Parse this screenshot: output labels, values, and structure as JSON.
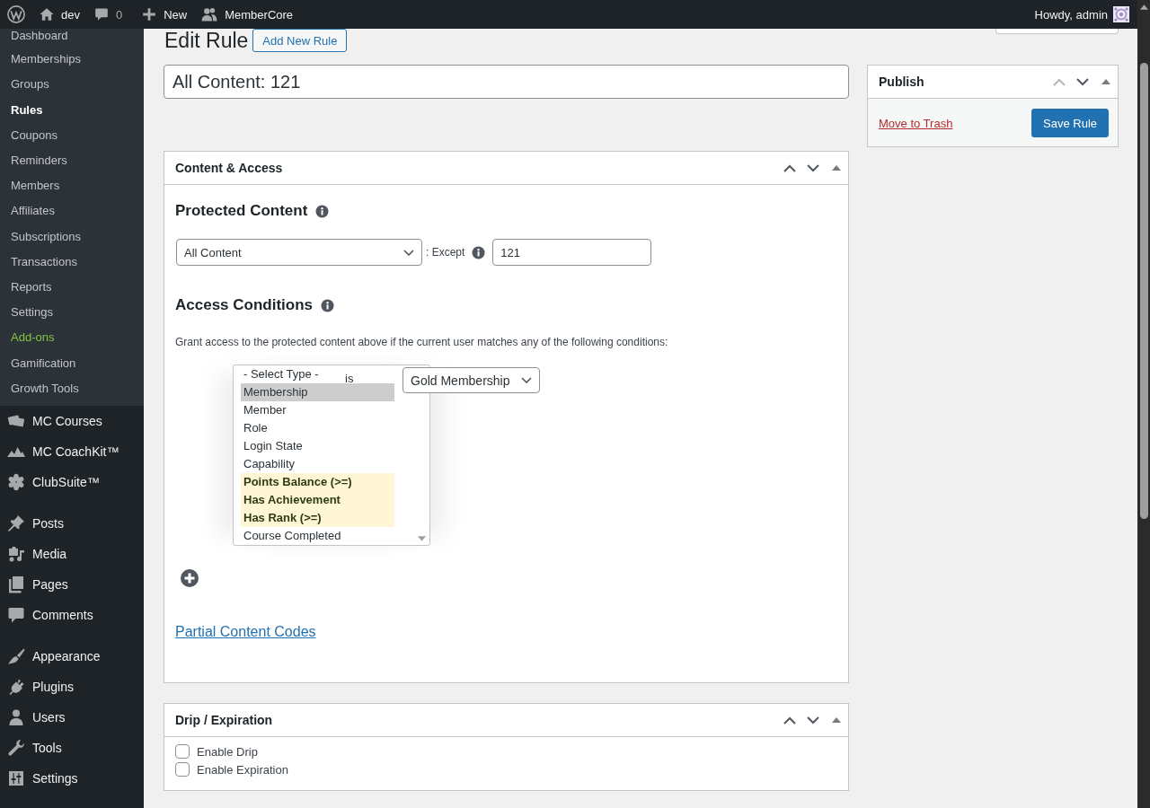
{
  "admin_bar": {
    "site_name": "dev",
    "comment_count": "0",
    "new_label": "New",
    "plugin_label": "MemberCore",
    "greeting": "Howdy, admin"
  },
  "sidebar": {
    "submenu": [
      {
        "label": "Dashboard",
        "selected": false
      },
      {
        "label": "Memberships",
        "selected": false
      },
      {
        "label": "Groups",
        "selected": false
      },
      {
        "label": "Rules",
        "selected": true
      },
      {
        "label": "Coupons",
        "selected": false
      },
      {
        "label": "Reminders",
        "selected": false
      },
      {
        "label": "Members",
        "selected": false
      },
      {
        "label": "Affiliates",
        "selected": false
      },
      {
        "label": "Subscriptions",
        "selected": false
      },
      {
        "label": "Transactions",
        "selected": false
      },
      {
        "label": "Reports",
        "selected": false
      },
      {
        "label": "Settings",
        "selected": false
      },
      {
        "label": "Add-ons",
        "selected": false,
        "color": "#82c341"
      },
      {
        "label": "Gamification",
        "selected": false
      },
      {
        "label": "Growth Tools",
        "selected": false
      }
    ],
    "menu_groups": [
      [
        {
          "label": "MC Courses",
          "selected": false
        },
        {
          "label": "MC CoachKit™",
          "selected": false
        },
        {
          "label": "ClubSuite™",
          "selected": false
        }
      ],
      [
        {
          "label": "Posts",
          "selected": false
        },
        {
          "label": "Media",
          "selected": false
        },
        {
          "label": "Pages",
          "selected": false
        },
        {
          "label": "Comments",
          "selected": false
        }
      ],
      [
        {
          "label": "Appearance",
          "selected": false
        },
        {
          "label": "Plugins",
          "selected": false
        },
        {
          "label": "Users",
          "selected": false
        },
        {
          "label": "Tools",
          "selected": false
        },
        {
          "label": "Settings",
          "selected": false
        }
      ]
    ]
  },
  "header": {
    "title": "Edit Rule",
    "add_button": "Add New Rule"
  },
  "rule_title": "All Content: 121",
  "content_access": {
    "title": "Content & Access",
    "move_up_disabled": false,
    "move_down_disabled": false,
    "expanded": true,
    "protected": {
      "heading": "Protected Content",
      "content_type": "All Content",
      "except_label": ": Except",
      "except_value": "121"
    },
    "access": {
      "heading": "Access Conditions",
      "description": "Grant access to the protected content above if the current user matches any of the following conditions:",
      "type_options": [
        {
          "label": "- Select Type -",
          "selected": false,
          "highlighted": false
        },
        {
          "label": "Membership",
          "selected": true,
          "highlighted": false
        },
        {
          "label": "Member",
          "selected": false,
          "highlighted": false
        },
        {
          "label": "Role",
          "selected": false,
          "highlighted": false
        },
        {
          "label": "Login State",
          "selected": false,
          "highlighted": false
        },
        {
          "label": "Capability",
          "selected": false,
          "highlighted": false
        },
        {
          "label": "Points Balance (>=)",
          "selected": false,
          "highlighted": true
        },
        {
          "label": "Has Achievement",
          "selected": false,
          "highlighted": true
        },
        {
          "label": "Has Rank (>=)",
          "selected": false,
          "highlighted": true
        },
        {
          "label": "Course Completed",
          "selected": false,
          "highlighted": false
        }
      ],
      "operator": "is",
      "value": "Gold Membership"
    },
    "partial_link": "Partial Content Codes"
  },
  "drip": {
    "title": "Drip / Expiration",
    "move_up_disabled": false,
    "move_down_disabled": false,
    "expanded": true,
    "options": [
      {
        "label": "Enable Drip",
        "checked": false
      },
      {
        "label": "Enable Expiration",
        "checked": false
      }
    ]
  },
  "publish": {
    "title": "Publish",
    "move_up_disabled": true,
    "move_down_disabled": false,
    "expanded": true,
    "trash_link": "Move to Trash",
    "save_button": "Save Rule"
  }
}
